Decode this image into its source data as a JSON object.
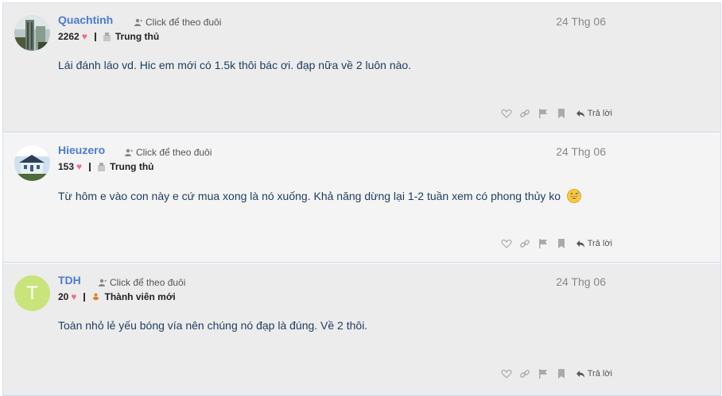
{
  "follow_label": "Click để theo đuôi",
  "reply_label": "Trả lời",
  "colors": {
    "username": "#4a7bd1",
    "heart": "#f06b86",
    "content_text": "#1c3c5e",
    "date": "#888888",
    "avatar_letter_bg": "#c9e47a"
  },
  "posts": [
    {
      "username": "Quachtinh",
      "score": "2262",
      "rank": "Trung thủ",
      "rank_icon": "badge-icon",
      "date": "24 Thg 06",
      "content": "Lái đánh láo vd. Hic em mới có 1.5k thôi bác ơi. đạp nữa về 2 luôn nào.",
      "avatar": "photo-tower"
    },
    {
      "username": "Hieuzero",
      "score": "153",
      "rank": "Trung thủ",
      "rank_icon": "badge-icon",
      "date": "24 Thg 06",
      "content": "Từ hôm e vào con này e cứ mua xong là nó xuống. Khả năng dừng lại 1-2 tuần xem có phong thủy ko",
      "avatar": "photo-house"
    },
    {
      "username": "TDH",
      "score": "20",
      "rank": "Thành viên mới",
      "rank_icon": "newbie-icon",
      "date": "24 Thg 06",
      "content": "Toàn nhỏ lẻ yếu bóng vía nên chúng nó đạp là đúng. Về 2 thôi.",
      "avatar_letter": "T"
    }
  ]
}
